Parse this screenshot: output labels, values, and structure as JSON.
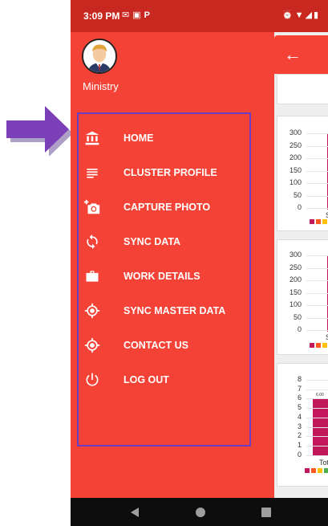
{
  "status_bar": {
    "time": "3:09 PM",
    "left_icons": [
      "gmail-icon",
      "ndtv-icon",
      "paytm-icon"
    ],
    "right_icons": [
      "alarm-icon",
      "wifi-icon",
      "signal-icon",
      "battery-icon"
    ]
  },
  "drawer": {
    "user_name": "Ministry",
    "menu": [
      {
        "label": "HOME",
        "icon": "bank-icon"
      },
      {
        "label": "CLUSTER PROFILE",
        "icon": "list-icon"
      },
      {
        "label": "CAPTURE PHOTO",
        "icon": "add-photo-icon"
      },
      {
        "label": "SYNC DATA",
        "icon": "sync-icon"
      },
      {
        "label": "WORK DETAILS",
        "icon": "briefcase-icon"
      },
      {
        "label": "SYNC MASTER DATA",
        "icon": "target-icon"
      },
      {
        "label": "CONTACT US",
        "icon": "target-icon"
      },
      {
        "label": "LOG OUT",
        "icon": "power-icon"
      }
    ]
  },
  "background": {
    "chart1": {
      "ticks": [
        "300",
        "250",
        "200",
        "150",
        "100",
        "50",
        "0"
      ],
      "xlabel_fragment": "S"
    },
    "chart2": {
      "ticks": [
        "300",
        "250",
        "200",
        "150",
        "100",
        "50",
        "0"
      ],
      "xlabel_fragment": "S"
    },
    "chart3": {
      "ticks": [
        "8",
        "7",
        "6",
        "5",
        "4",
        "3",
        "2",
        "1",
        "0"
      ],
      "xlabel_fragment": "Tot",
      "bar_label": "6.00"
    }
  },
  "colors": {
    "drawer": "#f44336",
    "status_bar": "#c8281f",
    "menu_box_border": "#6a3fc6",
    "arrow": "#7b3fb8",
    "bar": "#c2185b"
  }
}
